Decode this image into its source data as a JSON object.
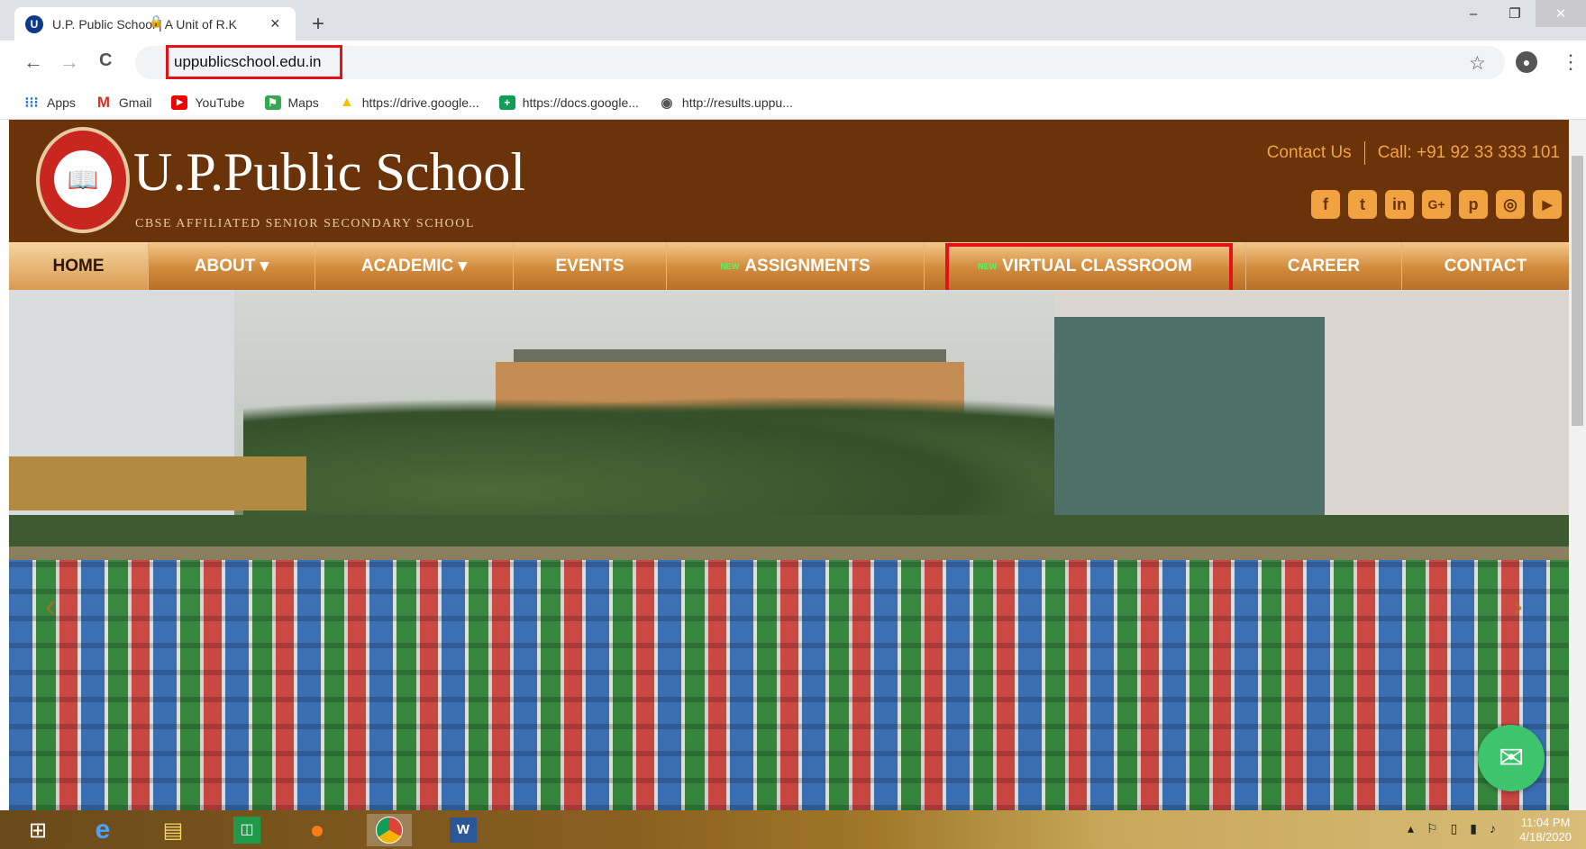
{
  "browser": {
    "tab_title": "U.P. Public School | A Unit of R.K",
    "tab_close": "×",
    "new_tab": "+",
    "url": "uppublicschool.edu.in",
    "window": {
      "minimize": "–",
      "restore": "❐",
      "close": "✕"
    },
    "nav": {
      "back": "←",
      "forward": "→",
      "reload": "C"
    },
    "bookmarks": [
      {
        "label": "Apps",
        "icon": "apps-grid-icon"
      },
      {
        "label": "Gmail",
        "icon": "gmail-icon"
      },
      {
        "label": "YouTube",
        "icon": "youtube-icon"
      },
      {
        "label": "Maps",
        "icon": "maps-icon"
      },
      {
        "label": "https://drive.google...",
        "icon": "drive-icon"
      },
      {
        "label": "https://docs.google...",
        "icon": "docs-icon"
      },
      {
        "label": "http://results.uppu...",
        "icon": "globe-icon"
      }
    ]
  },
  "site": {
    "name": "U.P.Public School",
    "tagline": "CBSE AFFILIATED SENIOR SECONDARY SCHOOL",
    "contact_link": "Contact Us",
    "phone": "Call: +91 92 33 333 101",
    "social": [
      {
        "icon": "facebook-icon",
        "glyph": "f"
      },
      {
        "icon": "twitter-icon",
        "glyph": "t"
      },
      {
        "icon": "linkedin-icon",
        "glyph": "in"
      },
      {
        "icon": "google-plus-icon",
        "glyph": "G+"
      },
      {
        "icon": "pinterest-icon",
        "glyph": "p"
      },
      {
        "icon": "instagram-icon",
        "glyph": "◎"
      },
      {
        "icon": "youtube-icon",
        "glyph": "▶"
      }
    ],
    "nav": [
      {
        "label": "HOME"
      },
      {
        "label": "ABOUT ▾"
      },
      {
        "label": "ACADEMIC ▾"
      },
      {
        "label": "EVENTS"
      },
      {
        "label": "ASSIGNMENTS",
        "new": "NEW"
      },
      {
        "label": "VIRTUAL CLASSROOM",
        "new": "NEW"
      },
      {
        "label": "CAREER"
      },
      {
        "label": "CONTACT"
      }
    ],
    "carousel": {
      "prev": "‹",
      "next": "›"
    },
    "mail_icon": "✉"
  },
  "taskbar": {
    "time": "11:04 PM",
    "date": "4/18/2020"
  },
  "colors": {
    "header_bg": "#6b3309",
    "nav_gold": "#d28a3a",
    "accent_orange": "#f0a340",
    "highlight_red": "#e3121a",
    "mail_green": "#3ec46d"
  }
}
